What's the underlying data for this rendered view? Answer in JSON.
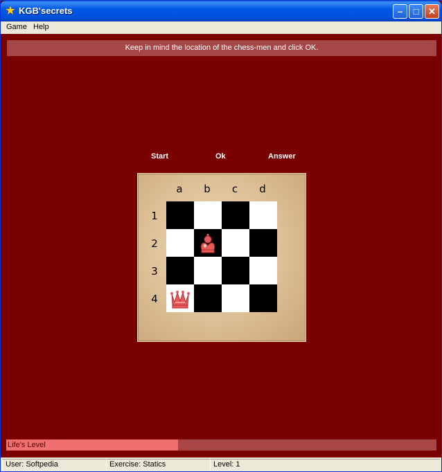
{
  "window": {
    "title": "KGB'secrets"
  },
  "menu": {
    "items": [
      "Game",
      "Help"
    ]
  },
  "message": "Keep in mind the location of the chess-men and click OK.",
  "actions": {
    "start": "Start",
    "ok": "Ok",
    "answer": "Answer"
  },
  "board": {
    "columns": [
      "a",
      "b",
      "c",
      "d"
    ],
    "rows": [
      "1",
      "2",
      "3",
      "4"
    ],
    "pieces": [
      {
        "type": "king-icon",
        "square": "b2"
      },
      {
        "type": "queen-icon",
        "square": "a4"
      }
    ]
  },
  "life": {
    "label": "Life's Level",
    "level": 0.4
  },
  "status": {
    "user": "User: Softpedia",
    "exercise": "Exercise: Statics",
    "level": "Level: 1"
  },
  "colors": {
    "background": "#7a0000",
    "message_bar": "#a54747",
    "life_fill": "#f07070",
    "piece": "#e85a5a"
  }
}
